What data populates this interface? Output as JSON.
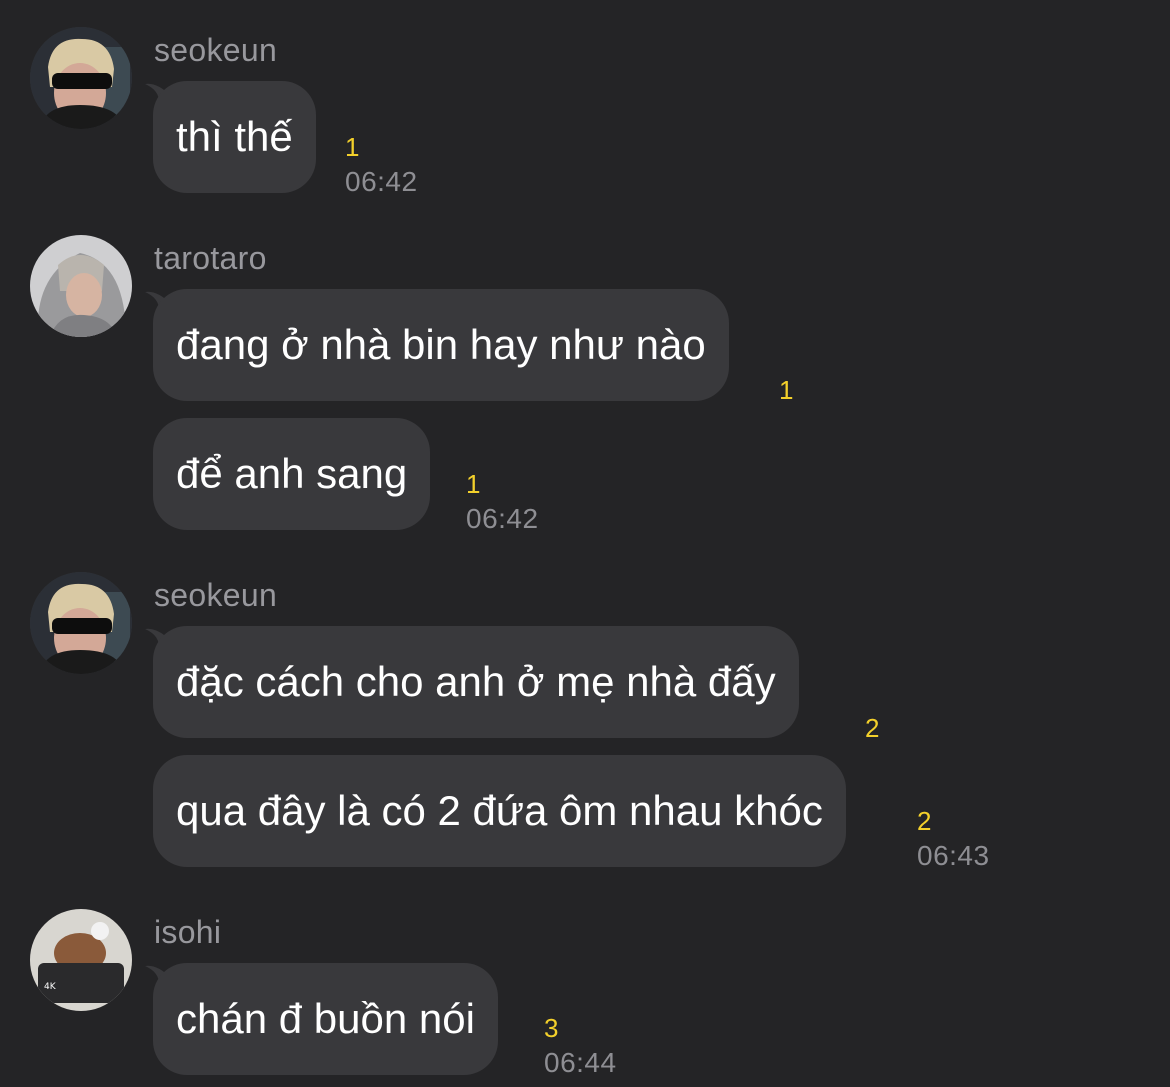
{
  "groups": [
    {
      "sender": "seokeun",
      "messages": [
        {
          "text": "thì thế",
          "unread": "1",
          "time": "06:42"
        }
      ]
    },
    {
      "sender": "tarotaro",
      "messages": [
        {
          "text": "đang ở nhà bin hay như nào",
          "unread": "1",
          "time": ""
        },
        {
          "text": "để anh sang",
          "unread": "1",
          "time": "06:42"
        }
      ]
    },
    {
      "sender": "seokeun",
      "messages": [
        {
          "text": "đặc cách cho anh ở mẹ nhà đấy",
          "unread": "2",
          "time": ""
        },
        {
          "text": "qua đây là có 2 đứa ôm nhau khóc",
          "unread": "2",
          "time": "06:43"
        }
      ]
    },
    {
      "sender": "isohi",
      "messages": [
        {
          "text": "chán đ buồn nói",
          "unread": "3",
          "time": "06:44"
        }
      ]
    }
  ],
  "theme": {
    "background": "#242426",
    "bubble": "#39393c",
    "unread_color": "#f3d02b",
    "meta_color": "#8e8e93"
  }
}
